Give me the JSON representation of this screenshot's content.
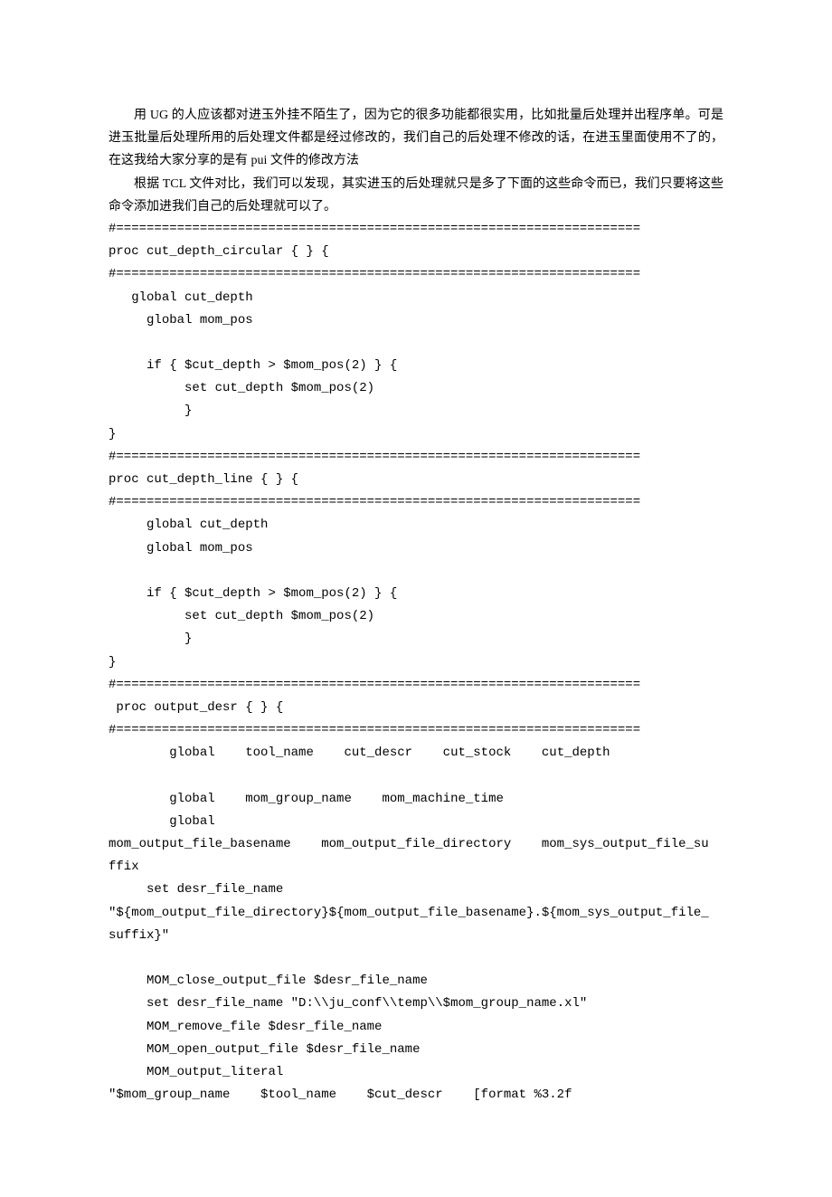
{
  "paragraphs": {
    "p1": "用 UG 的人应该都对进玉外挂不陌生了，因为它的很多功能都很实用，比如批量后处理并出程序单。可是进玉批量后处理所用的后处理文件都是经过修改的，我们自己的后处理不修改的话，在进玉里面使用不了的，在这我给大家分享的是有 pui 文件的修改方法",
    "p2": "根据 TCL 文件对比，我们可以发现，其实进玉的后处理就只是多了下面的这些命令而已，我们只要将这些命令添加进我们自己的后处理就可以了。"
  },
  "code_lines": [
    "#=====================================================================",
    "proc cut_depth_circular { } {",
    "#=====================================================================",
    "   global cut_depth",
    "     global mom_pos",
    "",
    "     if { $cut_depth > $mom_pos(2) } {",
    "          set cut_depth $mom_pos(2)",
    "          }",
    "}",
    "#=====================================================================",
    "proc cut_depth_line { } {",
    "#=====================================================================",
    "     global cut_depth",
    "     global mom_pos",
    "",
    "     if { $cut_depth > $mom_pos(2) } {",
    "          set cut_depth $mom_pos(2)",
    "          }",
    "}",
    "#=====================================================================",
    " proc output_desr { } {",
    "#=====================================================================",
    "        global    tool_name    cut_descr    cut_stock    cut_depth",
    "",
    "        global    mom_group_name    mom_machine_time",
    "        global",
    "mom_output_file_basename    mom_output_file_directory    mom_sys_output_file_su",
    "ffix",
    "     set desr_file_name",
    "\"${mom_output_file_directory}${mom_output_file_basename}.${mom_sys_output_file_",
    "suffix}\"",
    "",
    "     MOM_close_output_file $desr_file_name",
    "     set desr_file_name \"D:\\\\ju_conf\\\\temp\\\\$mom_group_name.xl\"",
    "     MOM_remove_file $desr_file_name",
    "     MOM_open_output_file $desr_file_name",
    "     MOM_output_literal",
    "\"$mom_group_name    $tool_name    $cut_descr    [format %3.2f"
  ]
}
